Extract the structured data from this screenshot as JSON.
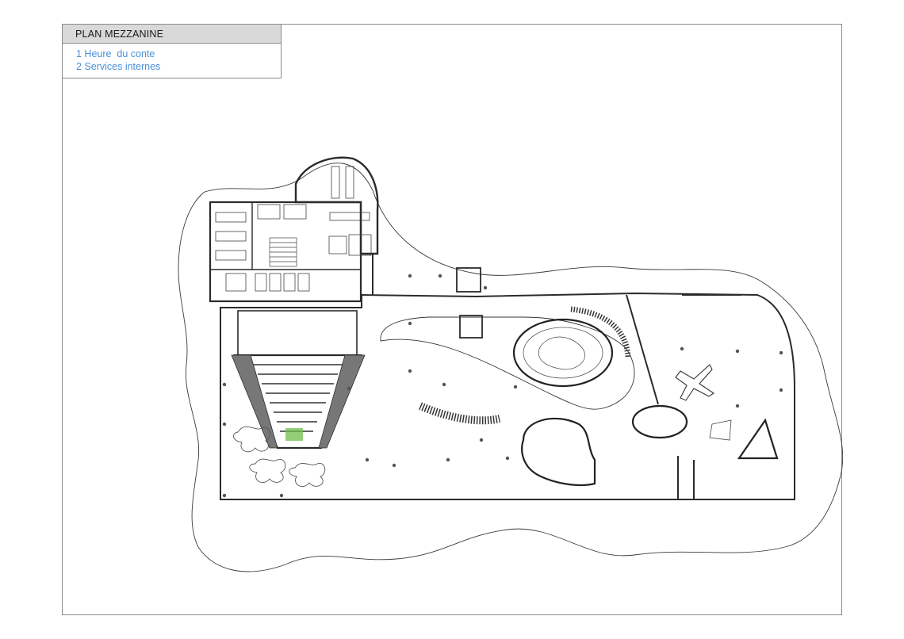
{
  "legend": {
    "title": "PLAN MEZZANINE",
    "items": [
      {
        "label": "1 Heure  du conte"
      },
      {
        "label": "2 Services internes"
      }
    ]
  },
  "colors": {
    "legend_text": "#4a8fd8",
    "title_bar": "#d9d9d9",
    "line": "#2b2b2b",
    "accent_green": "#6fbf4a"
  }
}
